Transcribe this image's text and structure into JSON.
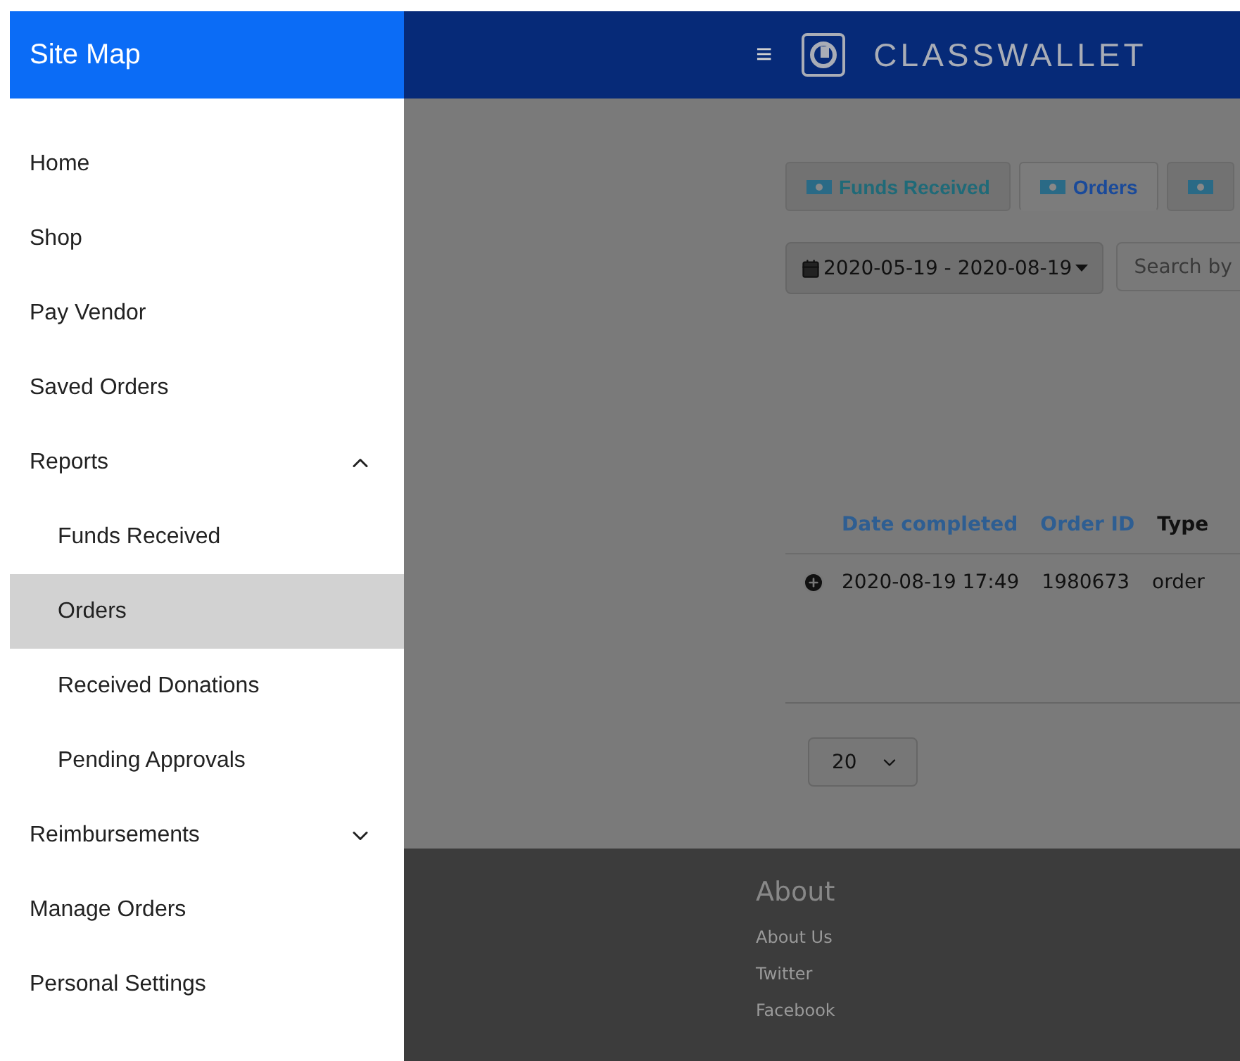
{
  "sidebar": {
    "title": "Site Map",
    "items": [
      {
        "label": "Home",
        "selected": false
      },
      {
        "label": "Shop",
        "selected": false
      },
      {
        "label": "Pay Vendor",
        "selected": false
      },
      {
        "label": "Saved Orders",
        "selected": false
      },
      {
        "label": "Reports",
        "selected": false,
        "expanded": true,
        "children": [
          {
            "label": "Funds Received",
            "selected": false
          },
          {
            "label": "Orders",
            "selected": true
          },
          {
            "label": "Received Donations",
            "selected": false
          },
          {
            "label": "Pending Approvals",
            "selected": false
          }
        ]
      },
      {
        "label": "Reimbursements",
        "selected": false,
        "expanded": false
      },
      {
        "label": "Manage Orders",
        "selected": false
      },
      {
        "label": "Personal Settings",
        "selected": false
      }
    ]
  },
  "header": {
    "menu_glyph": "≡",
    "logo_text": "CLASSWALLET"
  },
  "tabs": [
    {
      "label": "Funds Received",
      "selected": false
    },
    {
      "label": "Orders",
      "selected": true
    },
    {
      "selected": false
    }
  ],
  "filters": {
    "date_range": "2020-05-19 - 2020-08-19",
    "search_placeholder": "Search by"
  },
  "table": {
    "columns": [
      {
        "label": "Date completed",
        "sortable": true
      },
      {
        "label": "Order ID",
        "sortable": true
      },
      {
        "label": "Type",
        "sortable": false
      }
    ],
    "rows": [
      {
        "cells": [
          "2020-08-19 17:49",
          "1980673",
          "order"
        ]
      }
    ]
  },
  "page_size": "20",
  "footer": {
    "title": "About",
    "links": [
      "About Us",
      "Twitter",
      "Facebook"
    ]
  }
}
